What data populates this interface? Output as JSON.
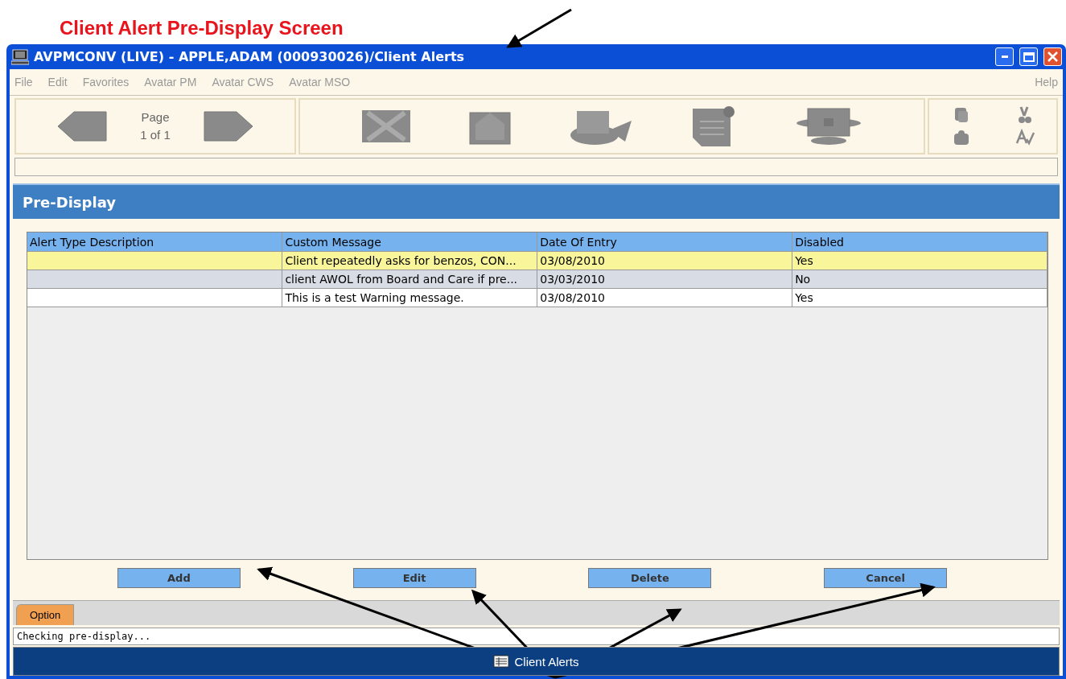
{
  "heading": "Client Alert Pre-Display Screen",
  "window": {
    "title": "AVPMCONV (LIVE) - APPLE,ADAM (000930026)/Client Alerts"
  },
  "menu": [
    {
      "label": "File",
      "disabled": true
    },
    {
      "label": "Edit",
      "disabled": true
    },
    {
      "label": "Favorites",
      "disabled": true
    },
    {
      "label": "Avatar PM",
      "disabled": true
    },
    {
      "label": "Avatar CWS",
      "disabled": true
    },
    {
      "label": "Avatar MSO",
      "disabled": true
    }
  ],
  "help_menu": "Help",
  "pager": {
    "line_1": "Page",
    "line_2": "1 of 1"
  },
  "section": {
    "title": "Pre-Display"
  },
  "table": {
    "columns": [
      "Alert Type Description",
      "Custom Message",
      "Date Of Entry",
      "Disabled"
    ],
    "rows": [
      {
        "cells": [
          "",
          "Client repeatedly asks for benzos, CON...",
          "03/08/2010",
          "Yes"
        ],
        "selected": true
      },
      {
        "cells": [
          "",
          "client AWOL from Board and Care if pre...",
          "03/03/2010",
          "No"
        ],
        "selected": false
      },
      {
        "cells": [
          "",
          "This is a test Warning message.",
          "03/08/2010",
          "Yes"
        ],
        "selected": false
      }
    ]
  },
  "buttons": [
    "Add",
    "Edit",
    "Delete",
    "Cancel"
  ],
  "tabs": [
    {
      "label": "Option",
      "selected": true
    }
  ],
  "status_bar": "Checking pre-display...",
  "taskbar": {
    "label": "Client Alerts"
  }
}
